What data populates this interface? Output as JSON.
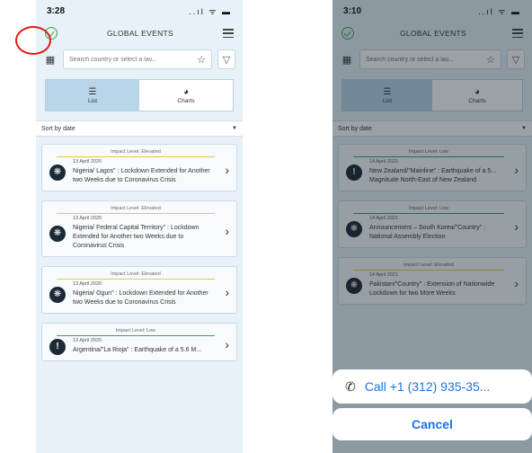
{
  "left": {
    "status": {
      "time": "3:28",
      "icons": "..ıl ᯤ ▬"
    },
    "header": {
      "title": "GLOBAL EVENTS"
    },
    "search": {
      "placeholder": "Search country or select a lav...",
      "map_icon": "map-icon",
      "star_icon": "star-icon",
      "filter_icon": "filter-icon"
    },
    "tabs": [
      {
        "label": "List",
        "icon": "list-icon"
      },
      {
        "label": "Charts",
        "icon": "chart-icon"
      }
    ],
    "sort": {
      "label": "Sort by date"
    },
    "cards": [
      {
        "level": "Impact Level: Elevated",
        "date": "13 April 2020",
        "title": "Nigeria/ Lagos\" : Lockdown Extended for Another two Weeks due to Coronavirus Crisis",
        "icon": "virus-icon"
      },
      {
        "level": "Impact Level: Elevated",
        "date": "13 April 2020",
        "title": "Nigeria/ Federal Capital Territory\" : Lockdown Extended for Another two Weeks due to Coronavirus Crisis",
        "icon": "virus-icon"
      },
      {
        "level": "Impact Level: Elevated",
        "date": "13 April 2020",
        "title": "Nigeria/ Ogun\" : Lockdown Extended for Another two Weeks due to Coronavirus Crisis",
        "icon": "virus-icon"
      },
      {
        "level": "Impact Level: Low",
        "date": "13 April 2020",
        "title": "Argentina/\"La Rioja\" : Earthquake of a 5.6 M...",
        "icon": "alert-icon"
      }
    ]
  },
  "right": {
    "status": {
      "time": "3:10",
      "icons": "..ıl ᯤ ▬"
    },
    "header": {
      "title": "GLOBAL EVENTS"
    },
    "search": {
      "placeholder": "Search country or select a lav..."
    },
    "tabs": [
      {
        "label": "List"
      },
      {
        "label": "Charts"
      }
    ],
    "sort": {
      "label": "Sort by date"
    },
    "cards": [
      {
        "level": "Impact Level: Low",
        "date": "14 April 2021",
        "title": "New Zealand/\"Mainline\" : Earthquake of a 5... Magnitude North-East of New Zealand",
        "icon": "alert-icon"
      },
      {
        "level": "Impact Level: Low",
        "date": "14 April 2021",
        "title": "Announcement – South Korea/\"Country\" : National Assembly Election",
        "icon": "virus-icon"
      },
      {
        "level": "Impact Level: Elevated",
        "date": "14 April 2021",
        "title": "Pakistan/\"Country\" : Extension of Nationwide Lockdown for two More Weeks",
        "icon": "virus-icon"
      }
    ],
    "sheet": {
      "call_label": "Call +1 (312) 935-35...",
      "cancel_label": "Cancel"
    }
  },
  "colors": {
    "highlight": "#e21b1b",
    "accent_green": "#39a845",
    "link_blue": "#1a73e8"
  }
}
